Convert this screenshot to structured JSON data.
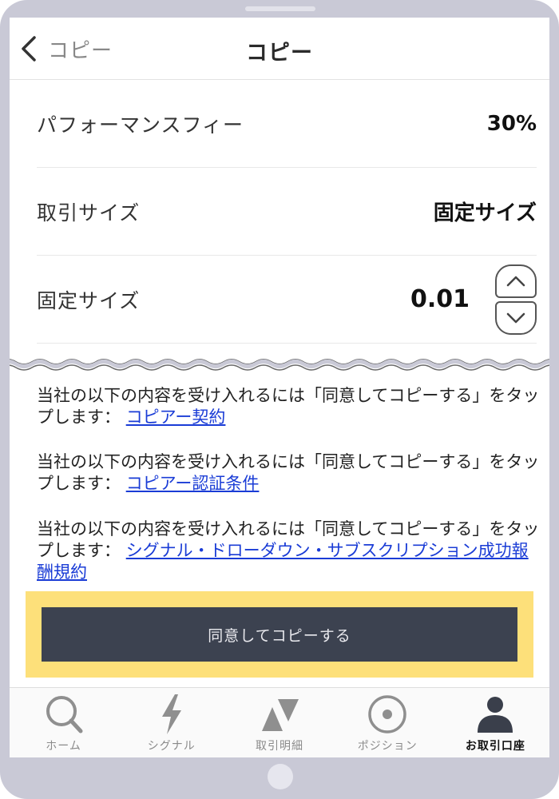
{
  "header": {
    "back_label": "コピー",
    "title": "コピー"
  },
  "settings": {
    "performance_fee": {
      "label": "パフォーマンスフィー",
      "value": "30%"
    },
    "trade_size": {
      "label": "取引サイズ",
      "value": "固定サイズ"
    },
    "fixed_size": {
      "label": "固定サイズ",
      "value": "0.01"
    }
  },
  "agreements": [
    {
      "text": "当社の以下の内容を受け入れるには「同意してコピーする」をタップします：",
      "link": "コピアー契約"
    },
    {
      "text": "当社の以下の内容を受け入れるには「同意してコピーする」をタップします：",
      "link": "コピアー認証条件"
    },
    {
      "text": "当社の以下の内容を受け入れるには「同意してコピーする」をタップします：",
      "link": "シグナル・ドローダウン・サブスクリプション成功報酬規約"
    }
  ],
  "cta": {
    "label": "同意してコピーする"
  },
  "tabs": [
    {
      "label": "ホーム",
      "icon": "search-icon",
      "active": false
    },
    {
      "label": "シグナル",
      "icon": "lightning-icon",
      "active": false
    },
    {
      "label": "取引明細",
      "icon": "trade-arrows-icon",
      "active": false
    },
    {
      "label": "ポジション",
      "icon": "target-icon",
      "active": false
    },
    {
      "label": "お取引口座",
      "icon": "person-icon",
      "active": true
    }
  ],
  "colors": {
    "accent_highlight": "#fde07a",
    "button_bg": "#3c4250",
    "link": "#1a3cd6",
    "device_frame": "#c9c9d6"
  }
}
